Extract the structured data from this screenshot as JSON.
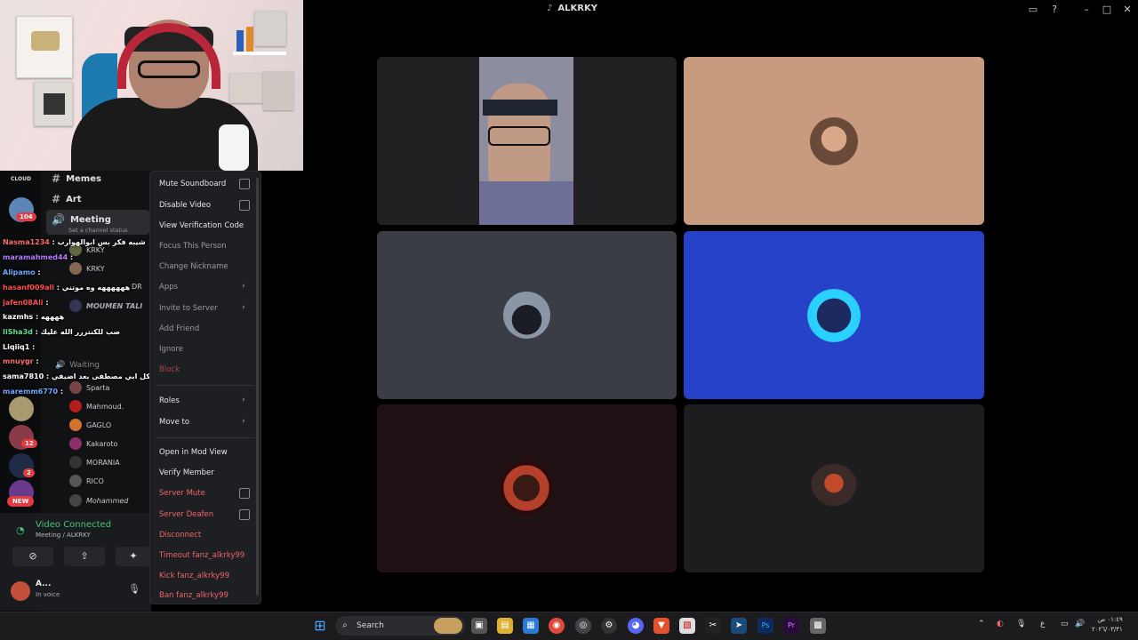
{
  "window": {
    "title": "ALKRKY"
  },
  "sidebar": {
    "channels": [
      {
        "label": "Memes"
      },
      {
        "label": "Art"
      },
      {
        "label": "Meeting"
      }
    ],
    "channel_status_placeholder": "Set a channel status",
    "server_badges": [
      "104",
      "12",
      "2"
    ],
    "new_badge": "NEW",
    "cloud_label": "CLOUD",
    "voice_users": [
      {
        "name": "KRKY"
      },
      {
        "name": "KRKY"
      },
      {
        "name": "DR"
      },
      {
        "name": "MOUMEN TALI"
      },
      {
        "name": "Waiting"
      },
      {
        "name": "Sparta"
      },
      {
        "name": "Mahmoud."
      },
      {
        "name": "GAGLO"
      },
      {
        "name": "Kakaroto"
      },
      {
        "name": "MORANIA"
      },
      {
        "name": "RICO"
      },
      {
        "name": "Mohammed"
      }
    ],
    "chat_messages": [
      {
        "user": "Nasma1234",
        "text": "شيبه فكر بس ابوالهوارب"
      },
      {
        "user": "maramahmed44",
        "text": ""
      },
      {
        "user": "Alipamo",
        "text": ""
      },
      {
        "user": "hasanf009ali",
        "text": "ههههههه وه موتني"
      },
      {
        "user": "jafen08Ali",
        "text": ""
      },
      {
        "user": "kazmhs",
        "text": "ههههه"
      },
      {
        "user": "IiSha3d",
        "text": "صب للكنتررر الله عليك"
      },
      {
        "user": "Liqiiq1",
        "text": ""
      },
      {
        "user": "mnuygr",
        "text": ""
      },
      {
        "user": "sama7810",
        "text": "شكل ابي مصطفى بعد اضيفي"
      },
      {
        "user": "maremm6770",
        "text": ""
      }
    ],
    "voice": {
      "title": "Video Connected",
      "subtitle": "Meeting / ALKRKY"
    },
    "user": {
      "name": "A...",
      "status": "In voice"
    }
  },
  "context_menu": {
    "items": [
      {
        "label": "Mute Soundboard",
        "type": "checkbox"
      },
      {
        "label": "Disable Video",
        "type": "checkbox"
      },
      {
        "label": "View Verification Code",
        "type": "normal"
      },
      {
        "label": "Focus This Person",
        "type": "dim"
      },
      {
        "label": "Change Nickname",
        "type": "dim"
      },
      {
        "label": "Apps",
        "type": "submenu"
      },
      {
        "label": "Invite to Server",
        "type": "submenu"
      },
      {
        "label": "Add Friend",
        "type": "dim"
      },
      {
        "label": "Ignore",
        "type": "dim"
      },
      {
        "label": "Block",
        "type": "red"
      },
      {
        "label": "Roles",
        "type": "submenu"
      },
      {
        "label": "Move to",
        "type": "submenu"
      },
      {
        "label": "Open in Mod View",
        "type": "normal"
      },
      {
        "label": "Verify Member",
        "type": "normal"
      },
      {
        "label": "Server Mute",
        "type": "red-checkbox"
      },
      {
        "label": "Server Deafen",
        "type": "red-checkbox"
      },
      {
        "label": "Disconnect",
        "type": "red"
      },
      {
        "label": "Timeout fanz_alkrky99",
        "type": "red"
      },
      {
        "label": "Kick fanz_alkrky99",
        "type": "red"
      },
      {
        "label": "Ban fanz_alkrky99",
        "type": "red"
      }
    ]
  },
  "video_tiles": [
    {
      "kind": "camera",
      "bg": "#202022"
    },
    {
      "kind": "avatar",
      "bg": "#c99b7e"
    },
    {
      "kind": "avatar",
      "bg": "#3a3d44"
    },
    {
      "kind": "avatar",
      "bg": "#2542c8"
    },
    {
      "kind": "avatar",
      "bg": "#201214"
    },
    {
      "kind": "avatar",
      "bg": "#1d1d20"
    }
  ],
  "taskbar": {
    "search_label": "Search",
    "clock_time": "٠١:٤٩ ص",
    "clock_date": "٢٠٢٦/٠٣/٣١",
    "lang": "ع"
  }
}
